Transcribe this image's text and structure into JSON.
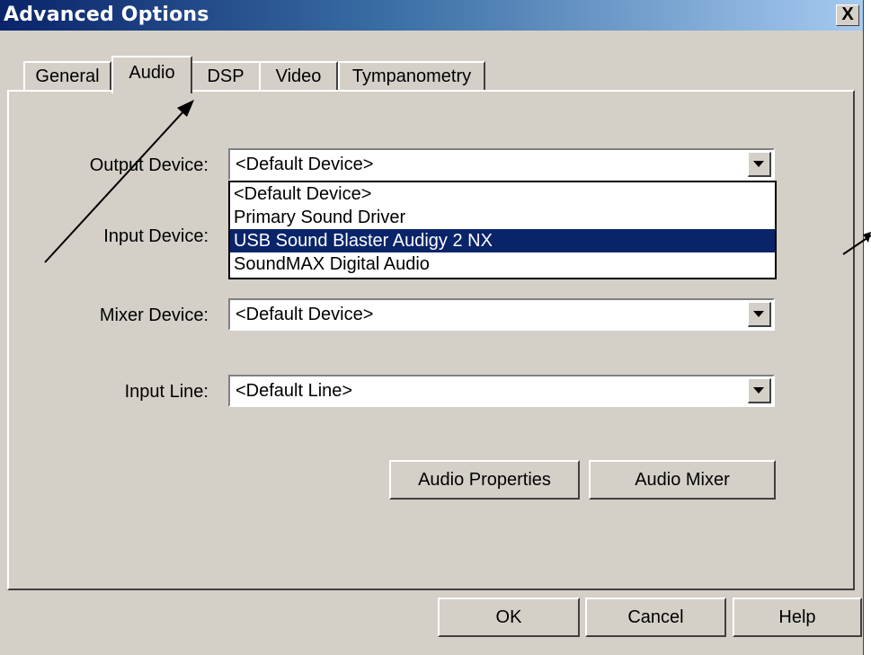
{
  "window": {
    "title": "Advanced Options",
    "close_glyph": "X"
  },
  "tabs": [
    {
      "label": "General",
      "active": false
    },
    {
      "label": "Audio",
      "active": true
    },
    {
      "label": "DSP",
      "active": false
    },
    {
      "label": "Video",
      "active": false
    },
    {
      "label": "Tympanometry",
      "active": false
    }
  ],
  "fields": {
    "output_device": {
      "label": "Output Device:",
      "value": "<Default Device>"
    },
    "input_device": {
      "label": "Input Device:"
    },
    "mixer_device": {
      "label": "Mixer Device:",
      "value": "<Default Device>"
    },
    "input_line": {
      "label": "Input Line:",
      "value": "<Default Line>"
    }
  },
  "dropdown": {
    "items": [
      "<Default Device>",
      "Primary Sound Driver",
      "USB Sound Blaster Audigy 2 NX",
      "SoundMAX Digital Audio"
    ],
    "selected_index": 2
  },
  "buttons": {
    "audio_properties": "Audio Properties",
    "audio_mixer": "Audio Mixer",
    "ok": "OK",
    "cancel": "Cancel",
    "help": "Help"
  },
  "colors": {
    "face": "#d4d0c8",
    "title_start": "#0a246a",
    "title_end": "#a6caf0",
    "selection": "#0a246a"
  },
  "icons": {
    "combo_arrow": "chevron-down-icon",
    "annotation": "arrow-annotation"
  }
}
